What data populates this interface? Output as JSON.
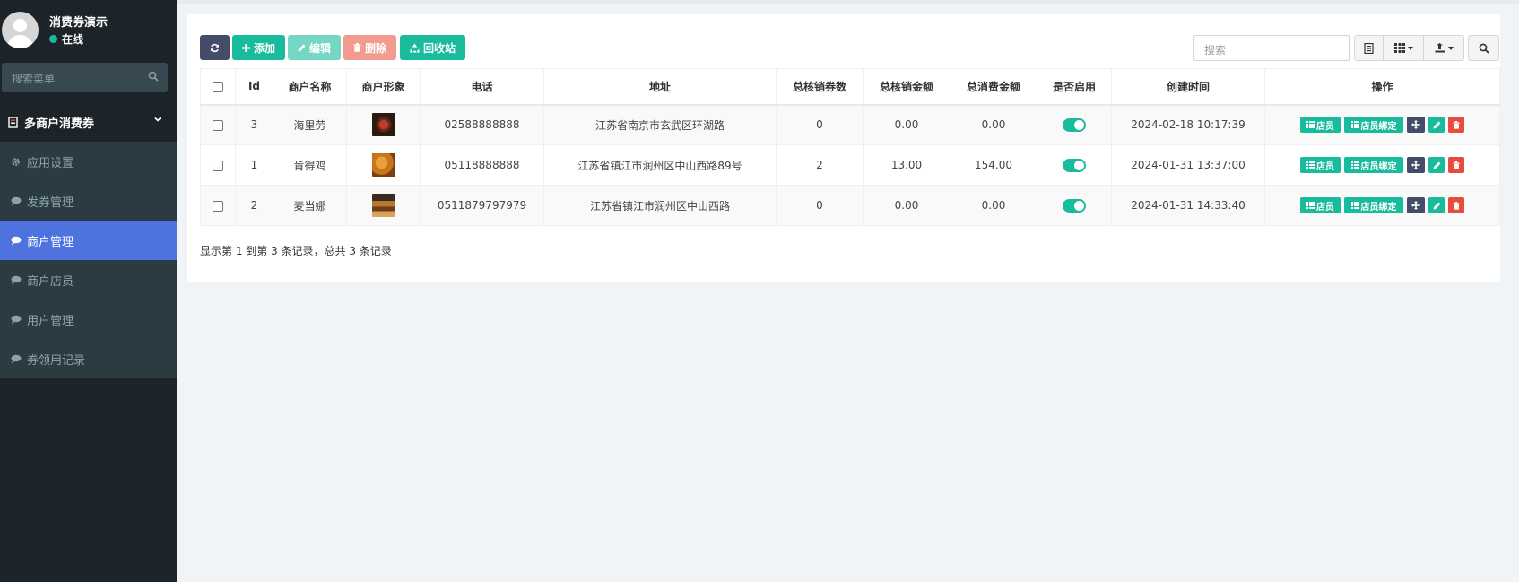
{
  "sidebar": {
    "username": "消费券演示",
    "status": "在线",
    "search_placeholder": "搜索菜单",
    "group_title": "多商户消费券",
    "items": [
      {
        "label": "应用设置",
        "icon": "gear-icon"
      },
      {
        "label": "发券管理",
        "icon": "chat-icon"
      },
      {
        "label": "商户管理",
        "icon": "chat-icon",
        "active": true
      },
      {
        "label": "商户店员",
        "icon": "chat-icon"
      },
      {
        "label": "用户管理",
        "icon": "chat-icon"
      },
      {
        "label": "券领用记录",
        "icon": "chat-icon"
      }
    ]
  },
  "toolbar": {
    "add_label": "添加",
    "edit_label": "编辑",
    "delete_label": "删除",
    "recycle_label": "回收站",
    "search_placeholder": "搜索"
  },
  "table": {
    "headers": [
      "Id",
      "商户名称",
      "商户形象",
      "电话",
      "地址",
      "总核销券数",
      "总核销金额",
      "总消费金额",
      "是否启用",
      "创建时间",
      "操作"
    ],
    "rows": [
      {
        "id": "3",
        "name": "海里劳",
        "phone": "02588888888",
        "address": "江苏省南京市玄武区环湖路",
        "redeemed_count": "0",
        "redeemed_amount": "0.00",
        "consumed_amount": "0.00",
        "enabled": true,
        "created": "2024-02-18 10:17:39"
      },
      {
        "id": "1",
        "name": "肯得鸡",
        "phone": "05118888888",
        "address": "江苏省镇江市润州区中山西路89号",
        "redeemed_count": "2",
        "redeemed_amount": "13.00",
        "consumed_amount": "154.00",
        "enabled": true,
        "created": "2024-01-31 13:37:00"
      },
      {
        "id": "2",
        "name": "麦当娜",
        "phone": "0511879797979",
        "address": "江苏省镇江市润州区中山西路",
        "redeemed_count": "0",
        "redeemed_amount": "0.00",
        "consumed_amount": "0.00",
        "enabled": true,
        "created": "2024-01-31 14:33:40"
      }
    ],
    "op_labels": {
      "shop_staff": "店员",
      "staff_bind": "店员绑定"
    }
  },
  "footer": {
    "summary": "显示第 1 到第 3 条记录，总共 3 条记录"
  },
  "colors": {
    "sidebar_bg": "#1c2429",
    "active_item": "#4e73df",
    "success": "#18bc9c",
    "danger": "#e74c3c",
    "dark_btn": "#444c69"
  }
}
